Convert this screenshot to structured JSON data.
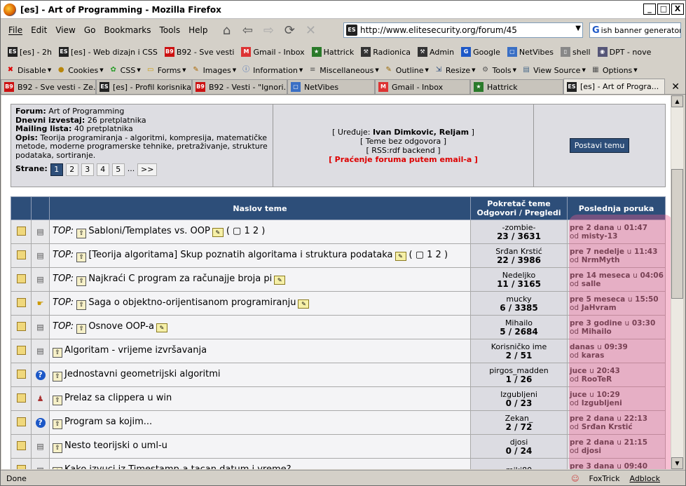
{
  "window": {
    "title": "[es] - Art of Programming - Mozilla Firefox",
    "minimize": "_",
    "maximize": "□",
    "close": "X"
  },
  "menu": [
    "File",
    "Edit",
    "View",
    "Go",
    "Bookmarks",
    "Tools",
    "Help"
  ],
  "url": "http://www.elitesecurity.org/forum/45",
  "search": {
    "engine": "G",
    "value": "ish banner generator"
  },
  "bookmarks": [
    {
      "icon": "es-icon",
      "label": "[es] - 2h"
    },
    {
      "icon": "es-icon",
      "label": "[es] - Web dizajn i CSS"
    },
    {
      "icon": "b92-icon",
      "label": "B92 - Sve vesti"
    },
    {
      "icon": "gmail-icon",
      "label": "Gmail - Inbox"
    },
    {
      "icon": "hattrick-icon",
      "label": "Hattrick"
    },
    {
      "icon": "hammer-icon",
      "label": "Radionica"
    },
    {
      "icon": "hammer-icon",
      "label": "Admin"
    },
    {
      "icon": "google-icon",
      "label": "Google"
    },
    {
      "icon": "netvibes-icon",
      "label": "NetVibes"
    },
    {
      "icon": "page-icon",
      "label": "shell"
    },
    {
      "icon": "dpt-icon",
      "label": "DPT - nove"
    }
  ],
  "devtools": [
    {
      "icon": "disable-icon",
      "label": "Disable"
    },
    {
      "icon": "cookies-icon",
      "label": "Cookies"
    },
    {
      "icon": "css-icon",
      "label": "CSS"
    },
    {
      "icon": "forms-icon",
      "label": "Forms"
    },
    {
      "icon": "images-icon",
      "label": "Images"
    },
    {
      "icon": "information-icon",
      "label": "Information"
    },
    {
      "icon": "misc-icon",
      "label": "Miscellaneous"
    },
    {
      "icon": "outline-icon",
      "label": "Outline"
    },
    {
      "icon": "resize-icon",
      "label": "Resize"
    },
    {
      "icon": "tools-icon",
      "label": "Tools"
    },
    {
      "icon": "viewsource-icon",
      "label": "View Source"
    },
    {
      "icon": "options-icon",
      "label": "Options"
    }
  ],
  "tabs": [
    {
      "icon": "b92-icon",
      "label": "B92 - Sve vesti - Ze...",
      "active": false
    },
    {
      "icon": "es-icon",
      "label": "[es] - Profil korisnika...",
      "active": false
    },
    {
      "icon": "b92-icon",
      "label": "B92 - Vesti - \"Ignori...",
      "active": false
    },
    {
      "icon": "netvibes-icon",
      "label": "NetVibes",
      "active": false
    },
    {
      "icon": "gmail-icon",
      "label": "Gmail - Inbox",
      "active": false
    },
    {
      "icon": "hattrick-icon",
      "label": "Hattrick",
      "active": false
    },
    {
      "icon": "es-icon",
      "label": "[es] - Art of Progra...",
      "active": true
    }
  ],
  "forum_info": {
    "forum_label": "Forum:",
    "forum_value": "Art of Programming",
    "daily_label": "Dnevni izvestaj:",
    "daily_value": "26 pretplatnika",
    "mail_label": "Mailing lista:",
    "mail_value": "40 pretplatnika",
    "opis_label": "Opis:",
    "opis_value": "Teorija programiranja - algoritmi, kompresija, matematičke metode, moderne programerske tehnike, pretraživanje, strukture podataka, sortiranje.",
    "strane_label": "Strane:",
    "pages": [
      "1",
      "2",
      "3",
      "4",
      "5",
      "...",
      ">>"
    ],
    "edit_label": "[ Uređuje:",
    "editors": "Ivan Dimkovic, Reljam",
    "edit_close": "]",
    "unanswered": "[ Teme bez odgovora ]",
    "rss": "[ RSS:rdf backend ]",
    "email_pre": "[",
    "email_track": "Praćenje foruma putem email-a",
    "email_post": "]",
    "post_button": "Postavi temu"
  },
  "table": {
    "head_title": "Naslov teme",
    "head_starter_1": "Pokretač teme",
    "head_starter_2": "Odgovori / Pregledi",
    "head_last": "Poslednja poruka",
    "rows": [
      {
        "top": "TOP:",
        "title": "Sabloni/Templates vs. OOP",
        "pages": "( ▢ 1 2 )",
        "note": true,
        "icon2": "printer-icon",
        "starter": "-zombie-",
        "stats": "23 / 3631",
        "when": "pre 2 dana",
        "u": "u",
        "time": "01:47",
        "od": "od",
        "user": "misty-13"
      },
      {
        "top": "TOP:",
        "title": "[Teorija algoritama] Skup poznatih algoritama i struktura podataka",
        "pages": "( ▢ 1 2 )",
        "note": true,
        "icon2": "printer-icon",
        "starter": "Srđan Krstić",
        "stats": "22 / 3986",
        "when": "pre 7 nedelje",
        "u": "u",
        "time": "11:43",
        "od": "od",
        "user": "NrmMyth"
      },
      {
        "top": "TOP:",
        "title": "Najkraći C program za računajje broja pi",
        "pages": "",
        "note": true,
        "icon2": "printer-icon",
        "starter": "Nedeljko",
        "stats": "11 / 3165",
        "when": "pre 14 meseca",
        "u": "u",
        "time": "04:06",
        "od": "od",
        "user": "salle"
      },
      {
        "top": "TOP:",
        "title": "Saga o objektno-orijentisanom programiranju",
        "pages": "",
        "note": true,
        "icon2": "hand-icon",
        "starter": "mucky",
        "stats": "6 / 3385",
        "when": "pre 5 meseca",
        "u": "u",
        "time": "15:50",
        "od": "od",
        "user": "JaHvram"
      },
      {
        "top": "TOP:",
        "title": "Osnove OOP-a",
        "pages": "",
        "note": true,
        "icon2": "printer-icon",
        "starter": "Mihailo",
        "stats": "5 / 2684",
        "when": "pre 3 godine",
        "u": "u",
        "time": "03:30",
        "od": "od",
        "user": "Mihailo"
      },
      {
        "top": "",
        "title": "Algoritam - vrijeme izvršavanja",
        "pages": "",
        "note": false,
        "icon2": "printer-icon",
        "starter": "Korisničko ime",
        "stats": "2 / 51",
        "when": "danas",
        "u": "u",
        "time": "09:39",
        "od": "od",
        "user": "karas"
      },
      {
        "top": "",
        "title": "Jednostavni geometrijski algoritmi",
        "pages": "",
        "note": false,
        "icon2": "question-icon",
        "starter": "pirgos_madden",
        "stats": "1 / 26",
        "when": "juce",
        "u": "u",
        "time": "20:43",
        "od": "od",
        "user": "RooTeR"
      },
      {
        "top": "",
        "title": "Prelaz sa clippera u win",
        "pages": "",
        "note": false,
        "icon2": "person-icon",
        "starter": "Izgubljeni",
        "stats": "0 / 23",
        "when": "juce",
        "u": "u",
        "time": "10:29",
        "od": "od",
        "user": "Izgubljeni"
      },
      {
        "top": "",
        "title": "Program sa kojim...",
        "pages": "",
        "note": false,
        "icon2": "question-icon",
        "starter": "Zekan_",
        "stats": "2 / 72",
        "when": "pre 2 dana",
        "u": "u",
        "time": "22:13",
        "od": "od",
        "user": "Srđan Krstić"
      },
      {
        "top": "",
        "title": "Nesto teorijski o uml-u",
        "pages": "",
        "note": false,
        "icon2": "printer-icon",
        "starter": "djosi",
        "stats": "0 / 24",
        "when": "pre 2 dana",
        "u": "u",
        "time": "21:15",
        "od": "od",
        "user": "djosi"
      },
      {
        "top": "",
        "title": "Kako izvuci iz Timestamp-a tacan datum i vreme?",
        "pages": "",
        "note": false,
        "icon2": "printer-icon",
        "starter": "miki80",
        "stats": "",
        "when": "pre 3 dana",
        "u": "u",
        "time": "09:40",
        "od": "od",
        "user": ""
      }
    ]
  },
  "status": {
    "text": "Done",
    "foxtrick": "FoxTrick",
    "adblock": "Adblock"
  },
  "colors": {
    "header_blue": "#2d4e79",
    "highlight": "#eb5a8c",
    "link_red": "#dd0000"
  }
}
